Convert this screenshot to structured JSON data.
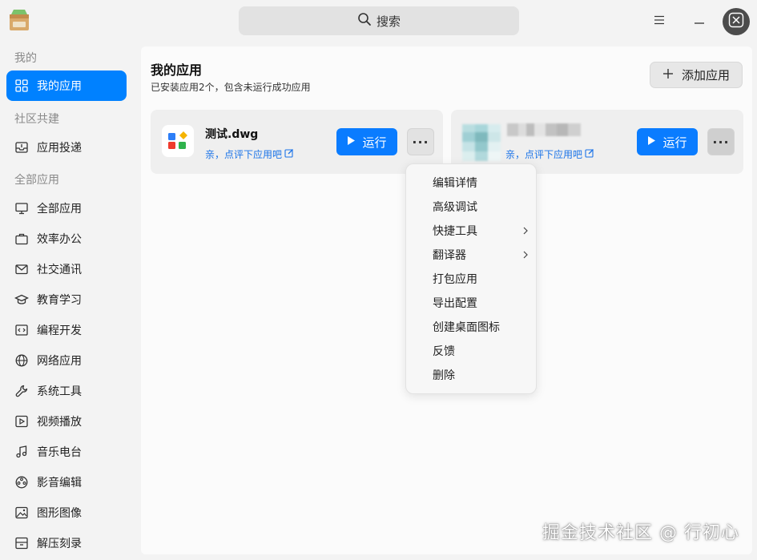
{
  "window": {
    "search_label": "搜索",
    "icons": [
      "app-store-icon",
      "search-icon",
      "menu-icon",
      "minimize-icon",
      "close-icon"
    ]
  },
  "sidebar": {
    "sections": [
      {
        "label": "我的",
        "items": [
          {
            "label": "我的应用",
            "icon": "grid-icon",
            "active": true
          }
        ]
      },
      {
        "label": "社区共建",
        "items": [
          {
            "label": "应用投递",
            "icon": "inbox-icon"
          }
        ]
      },
      {
        "label": "全部应用",
        "items": [
          {
            "label": "全部应用",
            "icon": "monitor-icon"
          },
          {
            "label": "效率办公",
            "icon": "briefcase-icon"
          },
          {
            "label": "社交通讯",
            "icon": "mail-icon"
          },
          {
            "label": "教育学习",
            "icon": "graduation-cap-icon"
          },
          {
            "label": "编程开发",
            "icon": "code-icon"
          },
          {
            "label": "网络应用",
            "icon": "globe-icon"
          },
          {
            "label": "系统工具",
            "icon": "wrench-icon"
          },
          {
            "label": "视频播放",
            "icon": "play-icon"
          },
          {
            "label": "音乐电台",
            "icon": "music-icon"
          },
          {
            "label": "影音编辑",
            "icon": "film-reel-icon"
          },
          {
            "label": "图形图像",
            "icon": "image-icon"
          },
          {
            "label": "解压刻录",
            "icon": "archive-icon"
          }
        ]
      }
    ]
  },
  "main": {
    "title": "我的应用",
    "subtitle": "已安装应用2个，包含未运行成功应用",
    "add_button": "添加应用",
    "apps": [
      {
        "name": "测试.dwg",
        "rate_text": "亲，点评下应用吧",
        "run_label": "运行",
        "more_label": "···"
      },
      {
        "name": "",
        "rate_text": "亲，点评下应用吧",
        "run_label": "运行",
        "more_label": "···",
        "obscured": true
      }
    ]
  },
  "context_menu": {
    "items": [
      {
        "label": "编辑详情",
        "submenu": false
      },
      {
        "label": "高级调试",
        "submenu": false
      },
      {
        "label": "快捷工具",
        "submenu": true
      },
      {
        "label": "翻译器",
        "submenu": true
      },
      {
        "label": "打包应用",
        "submenu": false
      },
      {
        "label": "导出配置",
        "submenu": false
      },
      {
        "label": "创建桌面图标",
        "submenu": false
      },
      {
        "label": "反馈",
        "submenu": false
      },
      {
        "label": "删除",
        "submenu": false
      }
    ]
  },
  "watermark": "掘金技术社区 @ 行初心",
  "colors": {
    "accent": "#0081ff",
    "run_button": "#0a7cff",
    "link": "#1a73e8"
  }
}
